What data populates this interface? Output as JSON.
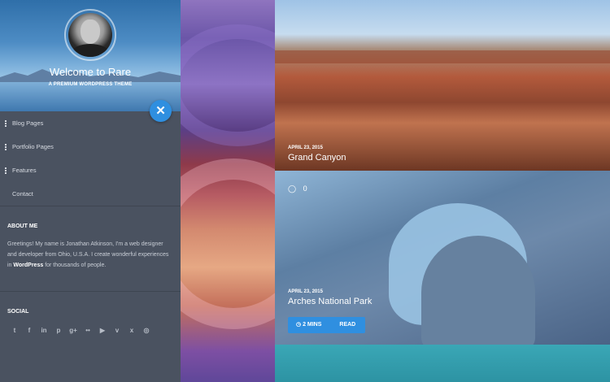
{
  "sidebar": {
    "title": "Welcome to Rare",
    "tagline": "A PREMIUM WORDPRESS THEME",
    "close_glyph": "✕",
    "nav": [
      {
        "label": "Blog Pages",
        "has_submenu": true
      },
      {
        "label": "Portfolio Pages",
        "has_submenu": true
      },
      {
        "label": "Features",
        "has_submenu": true
      },
      {
        "label": "Contact",
        "has_submenu": false
      }
    ],
    "about_heading": "ABOUT ME",
    "about_text_1": "Greetings! My name is Jonathan Atkinson, I'm a web designer and developer from Ohio, U.S.A. I create wonderful experiences in ",
    "about_link": "WordPress",
    "about_text_2": " for thousands of people.",
    "social_heading": "SOCIAL",
    "social_icons": [
      {
        "name": "twitter-icon",
        "glyph": "t"
      },
      {
        "name": "facebook-icon",
        "glyph": "f"
      },
      {
        "name": "linkedin-icon",
        "glyph": "in"
      },
      {
        "name": "pinterest-icon",
        "glyph": "p"
      },
      {
        "name": "google-plus-icon",
        "glyph": "g+"
      },
      {
        "name": "flickr-icon",
        "glyph": "••"
      },
      {
        "name": "youtube-icon",
        "glyph": "▶"
      },
      {
        "name": "vimeo-icon",
        "glyph": "v"
      },
      {
        "name": "xing-icon",
        "glyph": "x"
      },
      {
        "name": "instagram-icon",
        "glyph": "◎"
      }
    ]
  },
  "posts": [
    {
      "date": "APRIL 23, 2015",
      "title": "Grand Canyon"
    },
    {
      "date": "APRIL 23, 2015",
      "title": "Arches National Park",
      "comments": "0",
      "time_label": "2 MINS",
      "read_label": "READ"
    }
  ],
  "colors": {
    "accent": "#2f8fe0",
    "sidebar_bg": "#4a5260"
  }
}
